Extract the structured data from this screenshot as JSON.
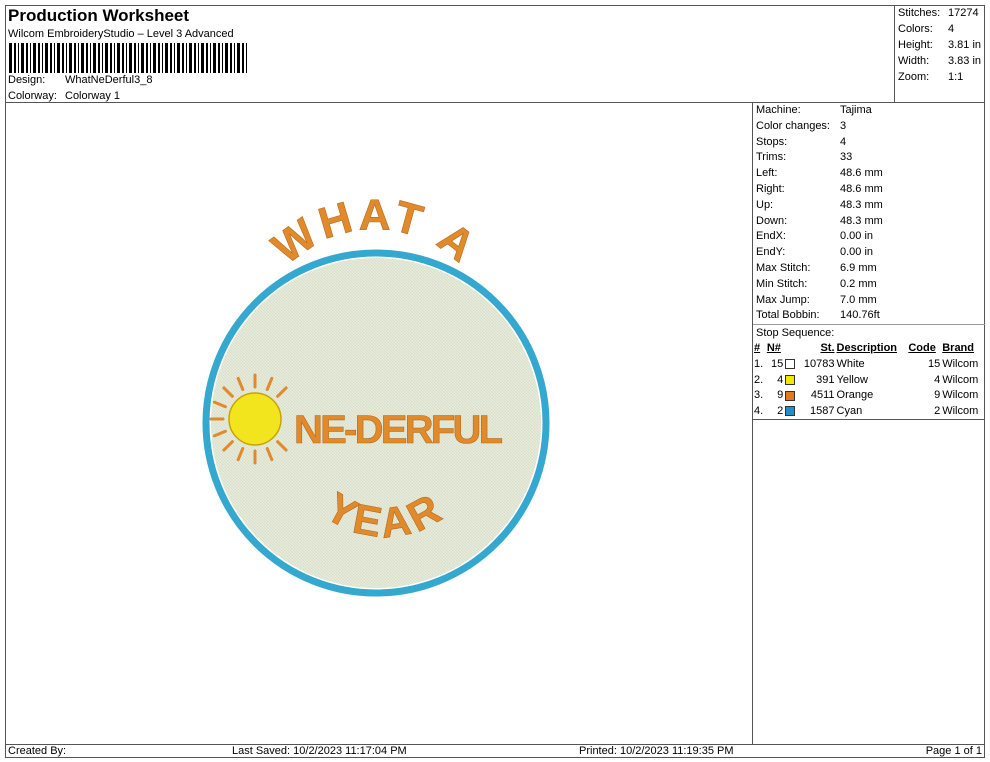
{
  "header": {
    "title": "Production Worksheet",
    "subtitle": "Wilcom EmbroideryStudio – Level 3 Advanced",
    "design_label": "Design:",
    "design_value": "WhatNeDerful3_8",
    "colorway_label": "Colorway:",
    "colorway_value": "Colorway 1"
  },
  "summary": [
    {
      "label": "Stitches:",
      "value": "17274"
    },
    {
      "label": "Colors:",
      "value": "4"
    },
    {
      "label": "Height:",
      "value": "3.81 in"
    },
    {
      "label": "Width:",
      "value": "3.83 in"
    },
    {
      "label": "Zoom:",
      "value": "1:1"
    }
  ],
  "machine_info": [
    {
      "label": "Machine:",
      "value": "Tajima"
    },
    {
      "label": "Color changes:",
      "value": "3"
    },
    {
      "label": "Stops:",
      "value": "4"
    },
    {
      "label": "Trims:",
      "value": "33"
    },
    {
      "label": "Left:",
      "value": "48.6 mm"
    },
    {
      "label": "Right:",
      "value": "48.6 mm"
    },
    {
      "label": "Up:",
      "value": "48.3 mm"
    },
    {
      "label": "Down:",
      "value": "48.3 mm"
    },
    {
      "label": "EndX:",
      "value": "0.00 in"
    },
    {
      "label": "EndY:",
      "value": "0.00 in"
    },
    {
      "label": "Max Stitch:",
      "value": "6.9 mm"
    },
    {
      "label": "Min Stitch:",
      "value": "0.2 mm"
    },
    {
      "label": "Max Jump:",
      "value": "7.0 mm"
    },
    {
      "label": "Total Bobbin:",
      "value": "140.76ft"
    }
  ],
  "stop_sequence": {
    "title": "Stop Sequence:",
    "headers": {
      "idx": "#",
      "n": "N#",
      "st": "St.",
      "desc": "Description",
      "code": "Code",
      "brand": "Brand"
    },
    "rows": [
      {
        "idx": "1.",
        "n": "15",
        "color": "#ffffff",
        "st": "10783",
        "desc": "White",
        "code": "15",
        "brand": "Wilcom"
      },
      {
        "idx": "2.",
        "n": "4",
        "color": "#f5e800",
        "st": "391",
        "desc": "Yellow",
        "code": "4",
        "brand": "Wilcom"
      },
      {
        "idx": "3.",
        "n": "9",
        "color": "#e07a1e",
        "st": "4511",
        "desc": "Orange",
        "code": "9",
        "brand": "Wilcom"
      },
      {
        "idx": "4.",
        "n": "2",
        "color": "#1e8fc8",
        "st": "1587",
        "desc": "Cyan",
        "code": "2",
        "brand": "Wilcom"
      }
    ]
  },
  "design": {
    "text_top": "WHAT A",
    "text_mid": "NE-DERFUL",
    "text_bottom": "YEAR",
    "colors": {
      "fill": "#e4e8d8",
      "border": "#35a8cf",
      "text": "#e08a2c",
      "sun": "#f2e51e"
    }
  },
  "footer": {
    "created": "Created By:",
    "saved": "Last Saved: 10/2/2023 11:17:04 PM",
    "printed": "Printed: 10/2/2023 11:19:35 PM",
    "page": "Page 1 of 1"
  }
}
